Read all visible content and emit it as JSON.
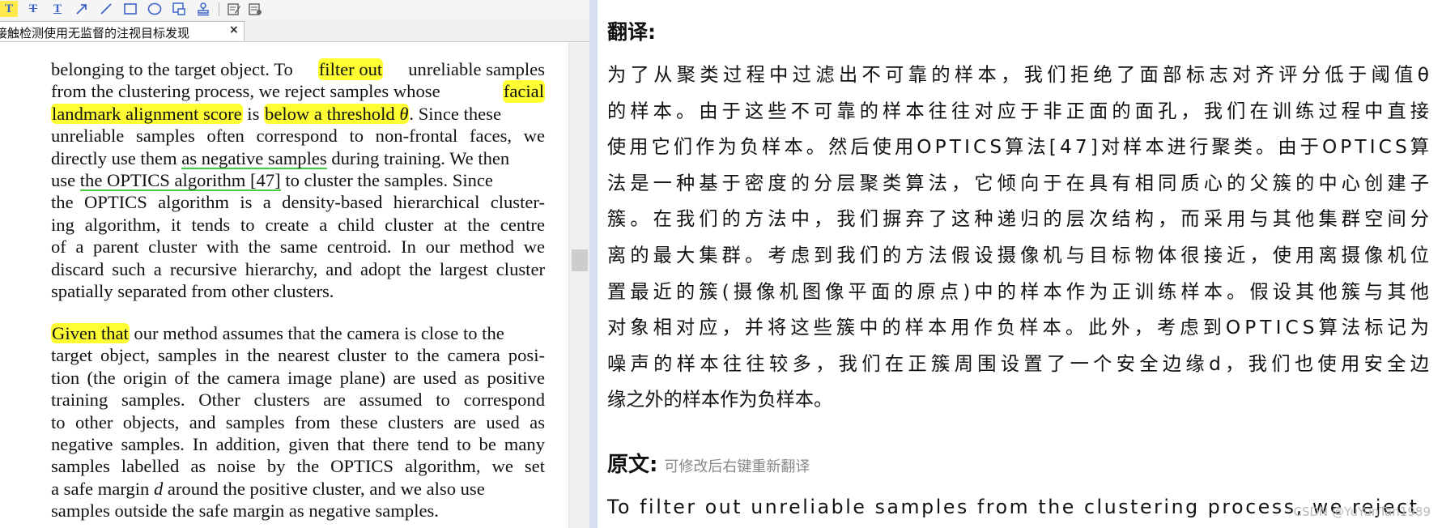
{
  "tab": {
    "title": "接触检测使用无监督的注视目标发现",
    "close": "×"
  },
  "toolbar": {
    "icons": [
      "highlight-text-icon",
      "strikethrough-text-icon",
      "text-tool-icon",
      "arrow-tool-icon",
      "line-tool-icon",
      "rectangle-tool-icon",
      "ellipse-tool-icon",
      "stamp-tool-icon",
      "signature-tool-icon",
      "edit-note-icon",
      "note-list-icon"
    ],
    "glyph_T": "T"
  },
  "doc": {
    "para1": [
      [
        "belonging to the target object. To ",
        "filter out",
        " unreliable samples"
      ],
      [
        "from the clustering process, we reject samples whose ",
        "facial"
      ],
      [
        "landmark alignment score",
        " is ",
        "below a threshold ",
        "θ",
        ". Since these"
      ],
      [
        "unreliable samples often correspond to non-frontal faces, we"
      ],
      [
        "directly use them ",
        "as negative samples",
        " during training. We then"
      ],
      [
        "use ",
        "the OPTICS algorithm [47]",
        " to cluster the samples. Since"
      ],
      [
        "the OPTICS algorithm is a density-based hierarchical cluster-"
      ],
      [
        "ing algorithm, it tends to create a child cluster at the centre"
      ],
      [
        "of a parent cluster with the same centroid. In our method we"
      ],
      [
        "discard such a recursive hierarchy, and adopt the largest cluster"
      ],
      [
        "spatially separated from other clusters."
      ]
    ],
    "para2": [
      [
        "Given that",
        " our method assumes that the camera is close to the"
      ],
      [
        "target object, samples in the nearest cluster to the camera posi-"
      ],
      [
        "tion (the origin of the camera image plane) are used as positive"
      ],
      [
        "training samples. Other clusters are assumed to correspond"
      ],
      [
        "to other objects, and samples from these clusters are used as"
      ],
      [
        "negative samples. In addition, given that there tend to be many"
      ],
      [
        "samples labelled as noise by the OPTICS algorithm, we set"
      ],
      [
        "a safe margin ",
        "d",
        " around the positive cluster, and we also use"
      ],
      [
        "samples outside the safe margin as negative samples."
      ]
    ]
  },
  "translation": {
    "heading": "翻译:",
    "lines": [
      "为了从聚类过程中过滤出不可靠的样本，我们拒绝了面部标志对齐评分低于阈值θ",
      "的样本。由于这些不可靠的样本往往对应于非正面的面孔，我们在训练过程中直接",
      "使用它们作为负样本。然后使用OPTICS算法[47]对样本进行聚类。由于OPTICS算",
      "法是一种基于密度的分层聚类算法，它倾向于在具有相同质心的父簇的中心创建子",
      "簇。在我们的方法中，我们摒弃了这种递归的层次结构，而采用与其他集群空间分",
      "离的最大集群。考虑到我们的方法假设摄像机与目标物体很接近，使用离摄像机位",
      "置最近的簇(摄像机图像平面的原点)中的样本作为正训练样本。假设其他簇与其他",
      "对象相对应，并将这些簇中的样本用作负样本。此外，考虑到OPTICS算法标记为",
      "噪声的样本往往较多，我们在正簇周围设置了一个安全边缘d，我们也使用安全边",
      "缘之外的样本作为负样本。"
    ]
  },
  "original": {
    "label": "原文:",
    "hint": "可修改后右键重新翻译",
    "text": "To filter out unreliable samples from the clustering process, we reject"
  },
  "watermark": "CSDN @YuYunTan1989",
  "colors": {
    "highlight": "#ffff33",
    "underline": "#44cc44",
    "divider": "#d5dff0",
    "toolbar_active": "#ffe94d"
  }
}
